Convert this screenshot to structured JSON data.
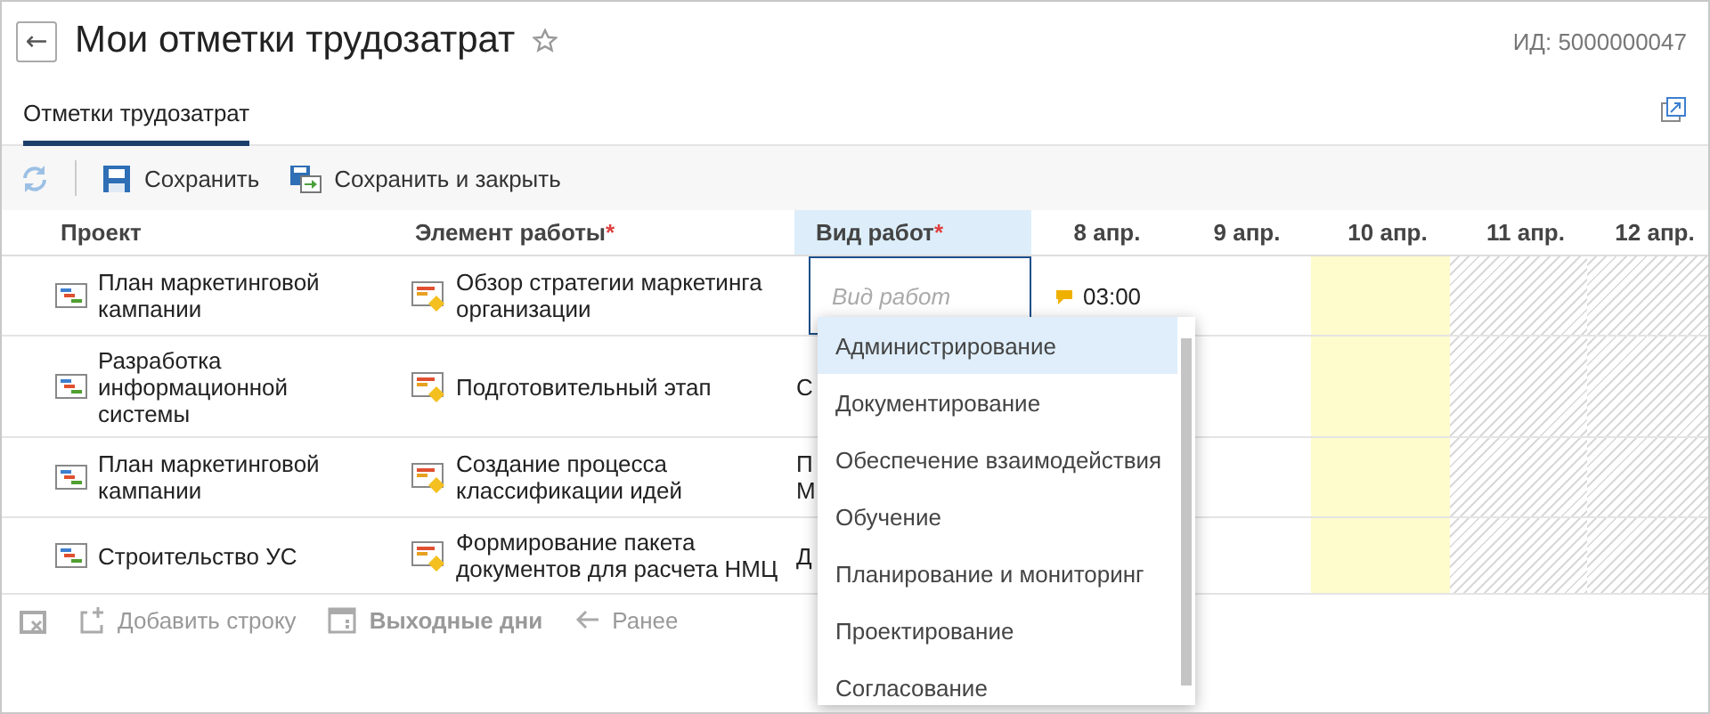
{
  "header": {
    "back": "←",
    "title": "Мои отметки трудозатрат",
    "starred": false,
    "id_label": "ИД: 5000000047"
  },
  "tabs": [
    {
      "label": "Отметки трудозатрат",
      "selected": true
    }
  ],
  "toolbar": [
    {
      "kind": "refresh",
      "disabled": true
    },
    {
      "kind": "save",
      "label": "Сохранить",
      "disabled": false
    },
    {
      "kind": "save_close",
      "label": "Сохранить и закрыть",
      "disabled": false
    }
  ],
  "table": {
    "columns": [
      {
        "label": "Проект",
        "focused": false
      },
      {
        "label": "Элемент работы",
        "required_mark": "*",
        "focused": false
      },
      {
        "label": "Вид работ",
        "required_mark": "*",
        "focused": true
      }
    ],
    "days": [
      {
        "label": "8 апр.",
        "highlighted": false,
        "non_working": false
      },
      {
        "label": "9 апр.",
        "highlighted": false,
        "non_working": false
      },
      {
        "label": "10 апр.",
        "highlighted": true,
        "non_working": false
      },
      {
        "label": "11 апр.",
        "highlighted": false,
        "non_working": true
      },
      {
        "label": "12 апр.",
        "highlighted": false,
        "non_working": true
      }
    ],
    "rows": [
      {
        "project": "План маркетинговой кампании",
        "work_item": "Обзор стратегии маркетинга организации",
        "work_type": {
          "placeholder": "Вид работ",
          "focused": true
        },
        "hours": [
          {
            "value": "03:00",
            "comment": true
          }
        ]
      },
      {
        "project": "Разработка информационной системы",
        "work_item": "Подготовительный этап",
        "work_type": {
          "lines": [
            "С"
          ],
          "focused": false
        },
        "hours": []
      },
      {
        "project": "План маркетинговой кампании",
        "work_item": "Создание процесса классификации идей",
        "work_type": {
          "lines": [
            "П",
            "М"
          ],
          "focused": false
        },
        "hours": []
      },
      {
        "project": "Строительство УС",
        "work_item": "Формирование пакета документов для расчета НМЦ",
        "work_type": {
          "lines": [
            "Д"
          ],
          "focused": false
        },
        "hours": []
      }
    ]
  },
  "footer": [
    {
      "kind": "clear",
      "disabled": true
    },
    {
      "kind": "add_row",
      "label": "Добавить строку",
      "disabled": true
    },
    {
      "kind": "weekends",
      "label": "Выходные дни",
      "disabled": true
    },
    {
      "kind": "earlier",
      "label": "Ранее",
      "disabled": true
    }
  ],
  "dropdown": {
    "items": [
      {
        "label": "Администрирование",
        "selected": true
      },
      {
        "label": "Документирование",
        "selected": false
      },
      {
        "label": "Обеспечение взаимодействия",
        "selected": false
      },
      {
        "label": "Обучение",
        "selected": false
      },
      {
        "label": "Планирование и мониторинг",
        "selected": false
      },
      {
        "label": "Проектирование",
        "selected": false
      },
      {
        "label": "Согласование",
        "selected": false
      }
    ]
  }
}
